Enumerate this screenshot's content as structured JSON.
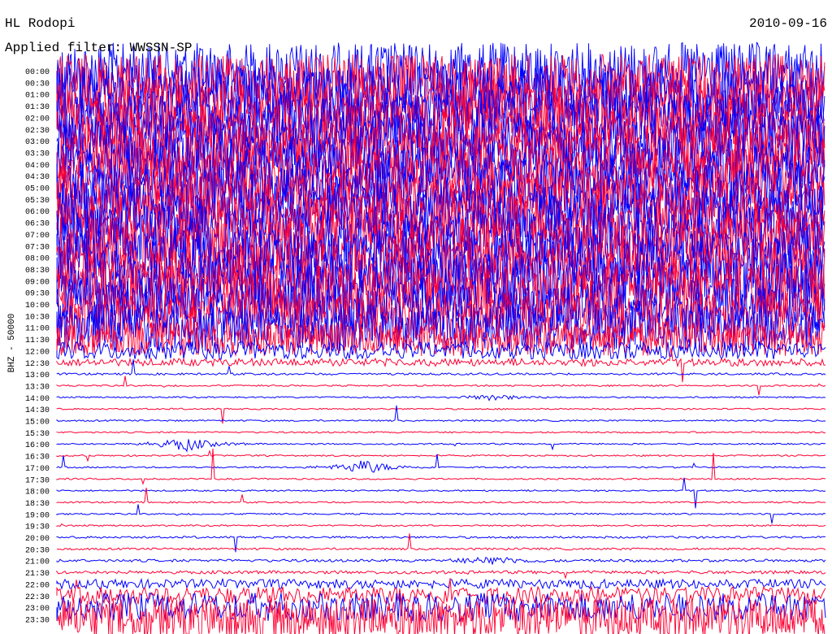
{
  "header": {
    "station": "HL Rodopi",
    "filter": "Applied filter: WWSSN-SP",
    "date": "2010-09-16"
  },
  "chart_data": {
    "type": "line",
    "title": "HL Rodopi",
    "date": "2010-09-16",
    "channel_label": "BHZ - 50000",
    "y_tick_labels": [
      "00:00",
      "00:30",
      "01:00",
      "01:30",
      "02:00",
      "02:30",
      "03:00",
      "03:30",
      "04:00",
      "04:30",
      "05:00",
      "05:30",
      "06:00",
      "06:30",
      "07:00",
      "07:30",
      "08:00",
      "08:30",
      "09:00",
      "09:30",
      "10:00",
      "10:30",
      "11:00",
      "11:30",
      "12:00",
      "12:30",
      "13:00",
      "13:30",
      "14:00",
      "14:30",
      "15:00",
      "15:30",
      "16:00",
      "16:30",
      "17:00",
      "17:30",
      "18:00",
      "18:30",
      "19:00",
      "19:30",
      "20:00",
      "20:30",
      "21:00",
      "21:30",
      "22:00",
      "22:30",
      "23:00",
      "23:30"
    ],
    "series_colors": [
      "#0000ff",
      "#ff0033"
    ],
    "noise_level_by_row": [
      1.0,
      1.0,
      1.0,
      1.0,
      1.0,
      1.0,
      1.0,
      1.0,
      1.0,
      1.0,
      1.0,
      1.0,
      1.0,
      1.0,
      1.0,
      1.0,
      1.0,
      1.0,
      1.0,
      1.0,
      0.95,
      0.9,
      0.85,
      0.6,
      0.3,
      0.12,
      0.02,
      0.01,
      0.01,
      0.01,
      0.01,
      0.01,
      0.01,
      0.01,
      0.01,
      0.01,
      0.01,
      0.01,
      0.01,
      0.01,
      0.02,
      0.02,
      0.03,
      0.04,
      0.15,
      0.3,
      0.5,
      0.7
    ],
    "events": [
      {
        "row": "16:00",
        "minute": 5,
        "amplitude": 1.0
      },
      {
        "row": "17:00",
        "minute": 12,
        "amplitude": 1.0
      },
      {
        "row": "21:00",
        "minute": 17,
        "amplitude": 0.6
      },
      {
        "row": "14:00",
        "minute": 17,
        "amplitude": 0.4
      }
    ],
    "grid": false
  }
}
